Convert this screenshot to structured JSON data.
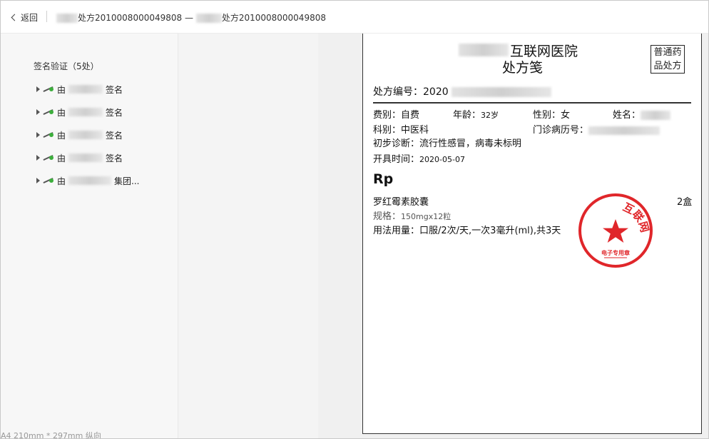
{
  "topbar": {
    "back_label": "返回",
    "title_part1": "处方2010008000049808",
    "title_dash": "—",
    "title_part2": "处方2010008000049808"
  },
  "signatures": {
    "header": "签名验证（5处）",
    "items": [
      {
        "prefix": "由",
        "suffix": "签名"
      },
      {
        "prefix": "由",
        "suffix": "签名"
      },
      {
        "prefix": "由",
        "suffix": "签名"
      },
      {
        "prefix": "由",
        "suffix": "签名"
      },
      {
        "prefix": "由",
        "suffix": "集团..."
      }
    ]
  },
  "prescription": {
    "hospital": "互联网医院",
    "doc_title": "处方笺",
    "category_line1": "普通药",
    "category_line2": "品处方",
    "rx_number_label": "处方编号：",
    "rx_number_prefix": "2020",
    "fee_label": "费别：",
    "fee_value": "自费",
    "age_label": "年龄：",
    "age_value": "32岁",
    "sex_label": "性别：",
    "sex_value": "女",
    "name_label": "姓名：",
    "dept_label": "科别：",
    "dept_value": "中医科",
    "clinic_no_label": "门诊病历号：",
    "diagnosis_label": "初步诊断：",
    "diagnosis_value": "流行性感冒，病毒未标明",
    "date_label": "开具时间：",
    "date_value": "2020-05-07",
    "rp": "Rp",
    "drug_name": "罗红霉素胶囊",
    "drug_qty": "2盒",
    "spec_label": "规格：",
    "spec_value": "150mgx12粒",
    "usage_label": "用法用量：",
    "usage_value": "口服/2次/天,一次3毫升(ml),共3天"
  },
  "stamp": {
    "text": "互联网医院",
    "bottom": "电子专用章",
    "color": "#e0262a"
  },
  "status": {
    "page_size": "A4 210mm * 297mm 纵向"
  }
}
